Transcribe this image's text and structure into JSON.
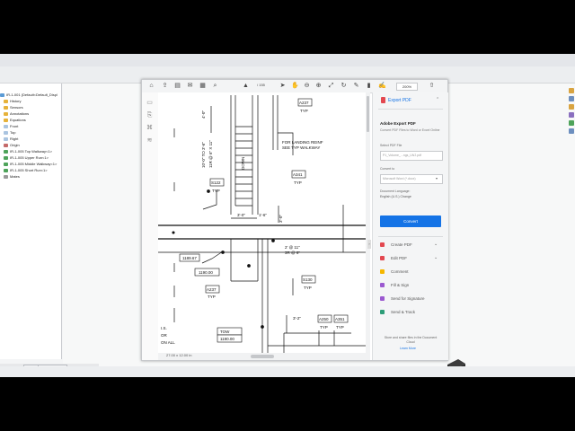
{
  "solidworks": {
    "feature_tree": {
      "items": [
        "IR-1-001 (Default<Default_Displ",
        "History",
        "Sensors",
        "Annotations",
        "Equations",
        "Front",
        "Top",
        "Right",
        "Origin",
        "IR-1-005 Top Walkway<1>",
        "IR-1-005 Upper Run<1>",
        "IR-1-005 Middle Walkway<1>",
        "IR-1-005 Short Run<1>",
        "Mates"
      ]
    },
    "tabs": [
      "Model",
      "Motion Study 1"
    ]
  },
  "acrobat": {
    "toolbar": {
      "page_counter": "/ 155",
      "zoom": "200%"
    },
    "page_size": "27.00 x 12.00 in",
    "drawing_labels": {
      "dim_4_0": "4'-0\"",
      "dim_10_0": "10'-0\" TO 3'-6\"",
      "dim_11r": "11R @ 6\" X 11\"",
      "down": "DOWN",
      "landing_note_1": "FOR LANDING REINF",
      "landing_note_2": "SEE TYP WALKWAY",
      "a237_top": "A237",
      "typ": "TYP",
      "a341": "A341",
      "s122": "S122",
      "dim_3_0": "3'-0\"",
      "dim_1_6": "1'-6\"",
      "dim_3_0_v": "3'-0\"",
      "dim_2_11": "2' @ 11\"",
      "dim_3r": "3R @ 6\"",
      "elev_1": "1189.67",
      "elev_2": "1190.00",
      "a237_low": "A237",
      "s130": "S130",
      "a250": "A250",
      "a351": "A351",
      "dim_3_2": "3'-2\"",
      "tow": "TOW",
      "elev_3": "1190.00",
      "side_note_1": "I.S.",
      "side_note_2": "OR",
      "side_note_3": "ON ALL"
    },
    "export_pane": {
      "title": "Export PDF",
      "section_title": "Adobe Export PDF",
      "description": "Convert PDF Files to Word or Excel Online",
      "select_label": "Select PDF File",
      "file_name": "P1_Volume_...ngs_LWJ.pdf",
      "convert_to_label": "Convert to",
      "convert_to_value": "Microsoft Word (*.docx)",
      "language_label": "Document Language:",
      "language_value": "English (U.S.)  Change",
      "convert_button": "Convert"
    },
    "tools": [
      {
        "label": "Create PDF",
        "icon": "create-pdf-icon",
        "color": "#e34850",
        "chevron": true
      },
      {
        "label": "Edit PDF",
        "icon": "edit-pdf-icon",
        "color": "#e34850",
        "chevron": true
      },
      {
        "label": "Comment",
        "icon": "comment-icon",
        "color": "#f5b700",
        "chevron": false
      },
      {
        "label": "Fill & Sign",
        "icon": "fill-sign-icon",
        "color": "#9b59d0",
        "chevron": false
      },
      {
        "label": "Send for Signature",
        "icon": "send-signature-icon",
        "color": "#9b59d0",
        "chevron": false
      },
      {
        "label": "Send & Track",
        "icon": "send-track-icon",
        "color": "#2d9d78",
        "chevron": false
      }
    ],
    "cloud_text": "Store and share files in the Document Cloud",
    "learn_more": "Learn More"
  },
  "colors": {
    "accent_blue": "#1473e6",
    "adobe_red": "#e34850"
  }
}
